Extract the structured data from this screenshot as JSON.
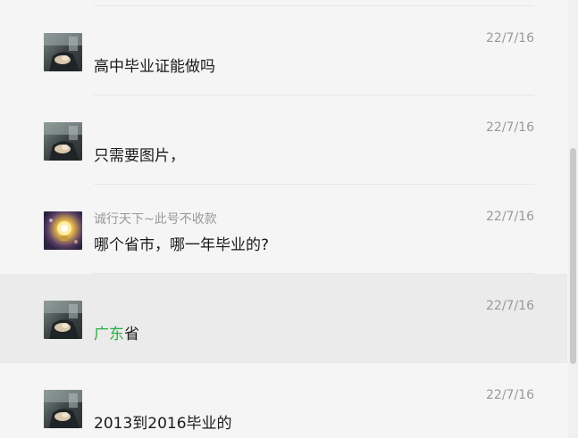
{
  "messages": [
    {
      "sender": "",
      "text": "高中毕业证能做吗",
      "date": "22/7/16",
      "avatar": "person-photo-avatar"
    },
    {
      "sender": "",
      "text": "只需要图片，",
      "date": "22/7/16",
      "avatar": "person-photo-avatar"
    },
    {
      "sender": "诚行天下~此号不收款",
      "text": "哪个省市，哪一年毕业的?",
      "date": "22/7/16",
      "avatar": "light-bulb-avatar"
    },
    {
      "sender": "",
      "text_highlight": "广东",
      "text_rest": "省",
      "date": "22/7/16",
      "avatar": "person-photo-avatar"
    },
    {
      "sender": "",
      "text": "2013到2016毕业的",
      "date": "22/7/16",
      "avatar": "person-photo-avatar"
    }
  ],
  "colors": {
    "background": "#f5f5f5",
    "highlight_row": "#ebebeb",
    "keyword": "#2aae48",
    "date_text": "#999999"
  }
}
